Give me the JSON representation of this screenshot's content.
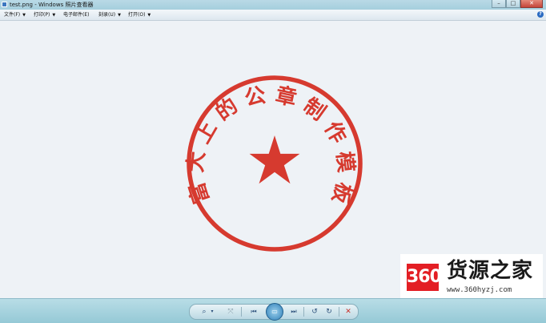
{
  "window": {
    "title": "test.png - Windows 照片查看器",
    "minimize": "–",
    "maximize": "□",
    "close": "✕"
  },
  "menu": {
    "items": [
      {
        "label": "文件(F)",
        "has_arrow": true
      },
      {
        "label": "打印(P)",
        "has_arrow": true
      },
      {
        "label": "电子邮件(E)",
        "has_arrow": false
      },
      {
        "label": "刻录(U)",
        "has_arrow": true
      },
      {
        "label": "打开(O)",
        "has_arrow": true
      }
    ],
    "help": "?"
  },
  "image": {
    "seal_text": "富大上的公章制作模板",
    "seal_color": "#d63a2f",
    "center": "star-icon"
  },
  "watermark": {
    "logo": "360",
    "title": "货源之家",
    "url": "www.360hyzj.com",
    "logo_color": "#e31e24"
  },
  "controls": {
    "zoom": "⌕",
    "zoom_arrow": "▾",
    "fit": "⤧",
    "prev": "⏮",
    "slideshow": "▭",
    "next": "⏭",
    "rotate_ccw": "↺",
    "rotate_cw": "↻",
    "delete": "✕"
  }
}
